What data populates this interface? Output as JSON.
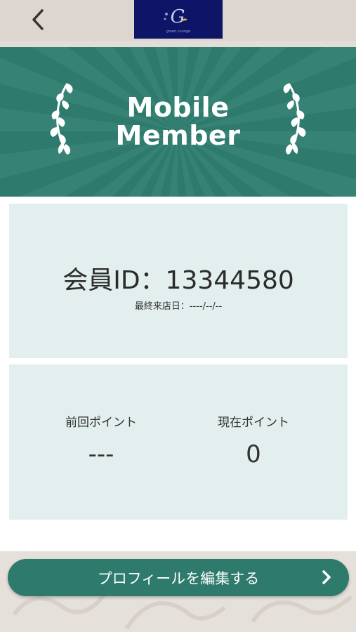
{
  "header": {
    "back_icon": "chevron-left-icon",
    "logo_text": "G",
    "logo_subtext": "green Lounge",
    "logo_bg": "#0f1566"
  },
  "banner": {
    "title_line1": "Mobile",
    "title_line2": "Member",
    "bg_color": "#2e7a6c",
    "decoration_icon": "laurel-branch-icon"
  },
  "member": {
    "id_label": "会員ID：",
    "id_value": "13344580",
    "last_visit_label": "最終来店日：",
    "last_visit_value": "----/--/--"
  },
  "points": {
    "previous_label": "前回ポイント",
    "previous_value": "---",
    "current_label": "現在ポイント",
    "current_value": "0"
  },
  "actions": {
    "edit_profile_label": "プロフィールを編集する",
    "edit_profile_icon": "chevron-right-icon"
  },
  "colors": {
    "accent": "#2e7a6c",
    "card_bg": "#e2efee",
    "header_bg": "#ddd5cf"
  }
}
